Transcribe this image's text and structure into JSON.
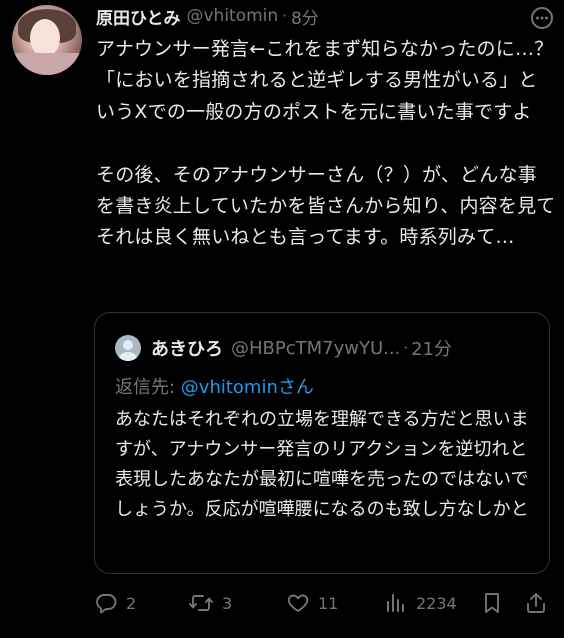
{
  "tweet": {
    "name": "原田ひとみ",
    "handle": "@vhitomin",
    "time": "8分",
    "body": "アナウンサー発言←これをまず知らなかったのに…？「においを指摘されると逆ギレする男性がいる」というXでの一般の方のポストを元に書いた事ですよ\n\nその後、そのアナウンサーさん（？）が、どんな事を書き炎上していたかを皆さんから知り、内容を見てそれは良く無いねとも言ってます。時系列みて…"
  },
  "quote": {
    "name": "あきひろ",
    "handle": "@HBPcTM7ywYU...",
    "time": "21分",
    "reply_prefix": "返信先: ",
    "reply_mention": "@vhitomin",
    "reply_suffix": "さん",
    "body": "あなたはそれぞれの立場を理解できる方だと思いますが、アナウンサー発言のリアクションを逆切れと表現したあなたが最初に喧嘩を売ったのではないでしょうか。反応が喧嘩腰になるのも致し方なしかと"
  },
  "actions": {
    "replies": "2",
    "retweets": "3",
    "likes": "11",
    "views": "2234"
  },
  "icons": [
    "more-icon",
    "reply-icon",
    "retweet-icon",
    "like-icon",
    "views-icon",
    "bookmark-icon",
    "share-icon"
  ],
  "colors": {
    "background": "#000000",
    "text": "#e7e9ea",
    "muted": "#71767b",
    "link": "#1d9bf0",
    "border": "#2f3336"
  }
}
